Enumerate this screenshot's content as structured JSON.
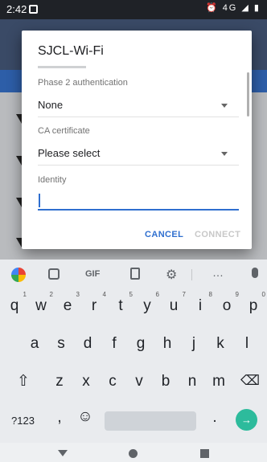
{
  "status_bar": {
    "time": "2:42",
    "icons_text": "⏰ 4G ◢ ▮"
  },
  "dialog": {
    "title": "SJCL-Wi-Fi",
    "phase2_label": "Phase 2 authentication",
    "phase2_value": "None",
    "ca_label": "CA certificate",
    "ca_value": "Please select",
    "identity_label": "Identity",
    "identity_value": "",
    "cancel_label": "CANCEL",
    "connect_label": "CONNECT"
  },
  "keyboard": {
    "suggestion_icons": [
      "google-icon",
      "sticker-icon",
      "gif-icon",
      "clipboard-icon",
      "settings-icon",
      "more-icon",
      "mic-icon"
    ],
    "gif_label": "GIF",
    "more_label": "…",
    "row1": [
      {
        "k": "q",
        "n": "1"
      },
      {
        "k": "w",
        "n": "2"
      },
      {
        "k": "e",
        "n": "3"
      },
      {
        "k": "r",
        "n": "4"
      },
      {
        "k": "t",
        "n": "5"
      },
      {
        "k": "y",
        "n": "6"
      },
      {
        "k": "u",
        "n": "7"
      },
      {
        "k": "i",
        "n": "8"
      },
      {
        "k": "o",
        "n": "9"
      },
      {
        "k": "p",
        "n": "0"
      }
    ],
    "row2": [
      "a",
      "s",
      "d",
      "f",
      "g",
      "h",
      "j",
      "k",
      "l"
    ],
    "row3": [
      "z",
      "x",
      "c",
      "v",
      "b",
      "n",
      "m"
    ],
    "sym_label": "?123",
    "comma": ",",
    "period": ".",
    "emoji": "☺",
    "shift": "⇧",
    "backspace": "⌫",
    "enter": "→"
  }
}
